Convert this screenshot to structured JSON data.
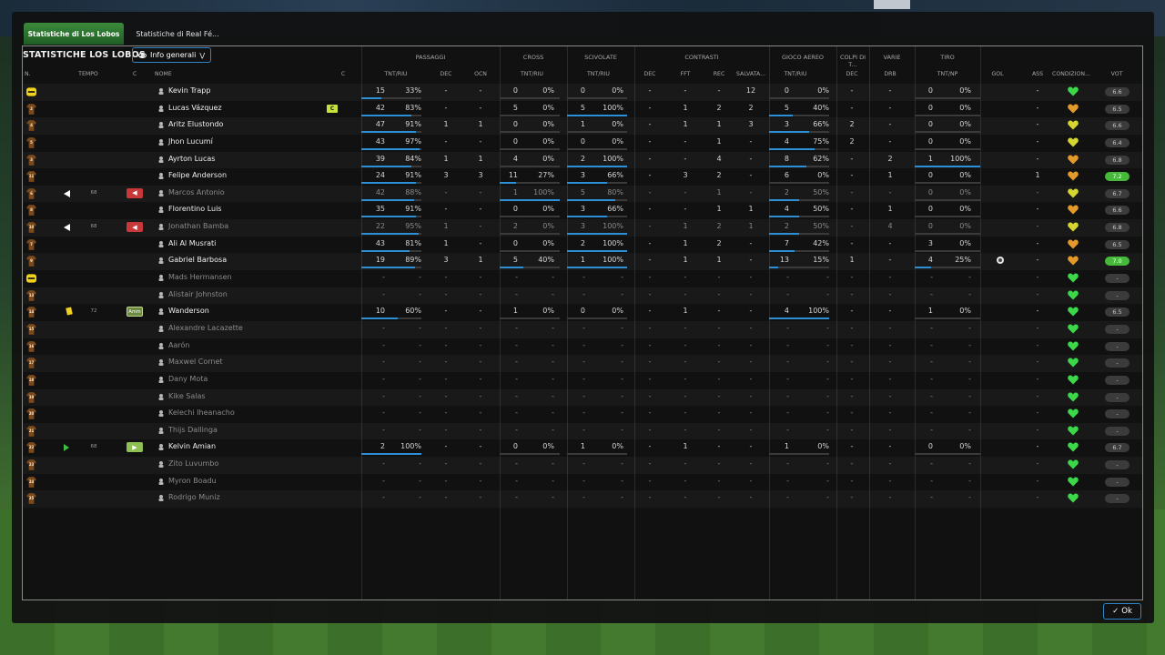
{
  "tabs": [
    {
      "label": "Statistiche di Los Lobos",
      "active": true
    },
    {
      "label": "Statistiche di Real Fé..."
    }
  ],
  "panel_title": "STATISTICHE LOS LOBOS",
  "view_selector": {
    "label": "Info generali",
    "icon": "eye-icon"
  },
  "group_headers": [
    "PASSAGGI",
    "CROSS",
    "SCIVOLATE",
    "CONTRASTI",
    "GIOCO AEREO",
    "COLPI DI T...",
    "VARIE",
    "TIRO"
  ],
  "column_headers": [
    "N.",
    "TEMPO",
    "C",
    "NOME",
    "C",
    "TNT/RIU",
    "DEC",
    "OCN",
    "TNT/RIU",
    "TNT/RIU",
    "DEC",
    "FFT",
    "REC",
    "SALVATA...",
    "TNT/RIU",
    "DEC",
    "DRB",
    "TNT/NP",
    "GOL",
    "ASS",
    "CONDIZION...",
    "VOT"
  ],
  "ok_label": "Ok",
  "accent_color": "#2f85c7",
  "players": [
    {
      "num": "1",
      "gk": true,
      "name": "Kevin Trapp",
      "pass_t": "15",
      "pass_p": "33%",
      "pass_pct": 33,
      "dec": "-",
      "ocn": "-",
      "cr_t": "0",
      "cr_p": "0%",
      "cr_pct": 0,
      "sc_t": "0",
      "sc_p": "0%",
      "sc_pct": 0,
      "con_dec": "-",
      "fft": "-",
      "rec": "-",
      "salv": "12",
      "air_t": "0",
      "air_p": "0%",
      "air_pct": 0,
      "colpi": "-",
      "drb": "-",
      "tiro_t": "0",
      "tiro_p": "0%",
      "tiro_pct": 0,
      "gol": "",
      "ass": "-",
      "cond": "green",
      "vote": "6.6",
      "dim": false
    },
    {
      "num": "2",
      "name": "Lucas Vázquez",
      "captain": "C",
      "pass_t": "42",
      "pass_p": "83%",
      "pass_pct": 83,
      "dec": "-",
      "ocn": "-",
      "cr_t": "5",
      "cr_p": "0%",
      "cr_pct": 0,
      "sc_t": "5",
      "sc_p": "100%",
      "sc_pct": 100,
      "con_dec": "-",
      "fft": "1",
      "rec": "2",
      "salv": "2",
      "air_t": "5",
      "air_p": "40%",
      "air_pct": 40,
      "colpi": "-",
      "drb": "-",
      "tiro_t": "0",
      "tiro_p": "0%",
      "tiro_pct": 0,
      "gol": "",
      "ass": "-",
      "cond": "orange",
      "vote": "6.5",
      "dim": false
    },
    {
      "num": "4",
      "name": "Aritz Elustondo",
      "pass_t": "47",
      "pass_p": "91%",
      "pass_pct": 91,
      "dec": "1",
      "ocn": "1",
      "cr_t": "0",
      "cr_p": "0%",
      "cr_pct": 0,
      "sc_t": "1",
      "sc_p": "0%",
      "sc_pct": 0,
      "con_dec": "-",
      "fft": "1",
      "rec": "1",
      "salv": "3",
      "air_t": "3",
      "air_p": "66%",
      "air_pct": 66,
      "colpi": "2",
      "drb": "-",
      "tiro_t": "0",
      "tiro_p": "0%",
      "tiro_pct": 0,
      "gol": "",
      "ass": "-",
      "cond": "yellow",
      "vote": "6.6",
      "dim": false
    },
    {
      "num": "5",
      "name": "Jhon Lucumí",
      "pass_t": "43",
      "pass_p": "97%",
      "pass_pct": 97,
      "dec": "-",
      "ocn": "-",
      "cr_t": "0",
      "cr_p": "0%",
      "cr_pct": 0,
      "sc_t": "0",
      "sc_p": "0%",
      "sc_pct": 0,
      "con_dec": "-",
      "fft": "-",
      "rec": "1",
      "salv": "-",
      "air_t": "4",
      "air_p": "75%",
      "air_pct": 75,
      "colpi": "2",
      "drb": "-",
      "tiro_t": "0",
      "tiro_p": "0%",
      "tiro_pct": 0,
      "gol": "",
      "ass": "-",
      "cond": "yellow",
      "vote": "6.4",
      "dim": false
    },
    {
      "num": "3",
      "name": "Ayrton Lucas",
      "pass_t": "39",
      "pass_p": "84%",
      "pass_pct": 84,
      "dec": "1",
      "ocn": "1",
      "cr_t": "4",
      "cr_p": "0%",
      "cr_pct": 0,
      "sc_t": "2",
      "sc_p": "100%",
      "sc_pct": 100,
      "con_dec": "-",
      "fft": "-",
      "rec": "4",
      "salv": "-",
      "air_t": "8",
      "air_p": "62%",
      "air_pct": 62,
      "colpi": "-",
      "drb": "2",
      "tiro_t": "1",
      "tiro_p": "100%",
      "tiro_pct": 100,
      "gol": "",
      "ass": "-",
      "cond": "orange",
      "vote": "6.8",
      "dim": false
    },
    {
      "num": "11",
      "name": "Felipe Anderson",
      "pass_t": "24",
      "pass_p": "91%",
      "pass_pct": 91,
      "dec": "3",
      "ocn": "3",
      "cr_t": "11",
      "cr_p": "27%",
      "cr_pct": 27,
      "sc_t": "3",
      "sc_p": "66%",
      "sc_pct": 66,
      "con_dec": "-",
      "fft": "3",
      "rec": "2",
      "salv": "-",
      "air_t": "6",
      "air_p": "0%",
      "air_pct": 0,
      "colpi": "-",
      "drb": "1",
      "tiro_t": "0",
      "tiro_p": "0%",
      "tiro_pct": 0,
      "gol": "",
      "ass": "1",
      "cond": "orange",
      "vote": "7.2",
      "vote_hi": true,
      "dim": false
    },
    {
      "num": "6",
      "sub_out": true,
      "minute": "68",
      "name": "Marcos Antonio",
      "pass_t": "42",
      "pass_p": "88%",
      "pass_pct": 88,
      "dec": "-",
      "ocn": "-",
      "cr_t": "1",
      "cr_p": "100%",
      "cr_pct": 100,
      "sc_t": "5",
      "sc_p": "80%",
      "sc_pct": 80,
      "con_dec": "-",
      "fft": "-",
      "rec": "1",
      "salv": "-",
      "air_t": "2",
      "air_p": "50%",
      "air_pct": 50,
      "colpi": "-",
      "drb": "-",
      "tiro_t": "0",
      "tiro_p": "0%",
      "tiro_pct": 0,
      "gol": "",
      "ass": "-",
      "cond": "yellow",
      "vote": "6.7",
      "dim": true
    },
    {
      "num": "8",
      "name": "Florentino Luis",
      "pass_t": "35",
      "pass_p": "91%",
      "pass_pct": 91,
      "dec": "-",
      "ocn": "-",
      "cr_t": "0",
      "cr_p": "0%",
      "cr_pct": 0,
      "sc_t": "3",
      "sc_p": "66%",
      "sc_pct": 66,
      "con_dec": "-",
      "fft": "-",
      "rec": "1",
      "salv": "1",
      "air_t": "4",
      "air_p": "50%",
      "air_pct": 50,
      "colpi": "-",
      "drb": "1",
      "tiro_t": "0",
      "tiro_p": "0%",
      "tiro_pct": 0,
      "gol": "",
      "ass": "-",
      "cond": "orange",
      "vote": "6.6",
      "dim": false
    },
    {
      "num": "10",
      "sub_out": true,
      "minute": "68",
      "name": "Jonathan Bamba",
      "pass_t": "22",
      "pass_p": "95%",
      "pass_pct": 95,
      "dec": "1",
      "ocn": "-",
      "cr_t": "2",
      "cr_p": "0%",
      "cr_pct": 0,
      "sc_t": "3",
      "sc_p": "100%",
      "sc_pct": 100,
      "con_dec": "-",
      "fft": "1",
      "rec": "2",
      "salv": "1",
      "air_t": "2",
      "air_p": "50%",
      "air_pct": 50,
      "colpi": "-",
      "drb": "4",
      "tiro_t": "0",
      "tiro_p": "0%",
      "tiro_pct": 0,
      "gol": "",
      "ass": "-",
      "cond": "yellow",
      "vote": "6.8",
      "dim": true
    },
    {
      "num": "7",
      "name": "Ali Al Musrati",
      "pass_t": "43",
      "pass_p": "81%",
      "pass_pct": 81,
      "dec": "1",
      "ocn": "-",
      "cr_t": "0",
      "cr_p": "0%",
      "cr_pct": 0,
      "sc_t": "2",
      "sc_p": "100%",
      "sc_pct": 100,
      "con_dec": "-",
      "fft": "1",
      "rec": "2",
      "salv": "-",
      "air_t": "7",
      "air_p": "42%",
      "air_pct": 42,
      "colpi": "-",
      "drb": "-",
      "tiro_t": "3",
      "tiro_p": "0%",
      "tiro_pct": 0,
      "gol": "",
      "ass": "-",
      "cond": "orange",
      "vote": "6.5",
      "dim": false
    },
    {
      "num": "9",
      "name": "Gabriel Barbosa",
      "pass_t": "19",
      "pass_p": "89%",
      "pass_pct": 89,
      "dec": "3",
      "ocn": "1",
      "cr_t": "5",
      "cr_p": "40%",
      "cr_pct": 40,
      "sc_t": "1",
      "sc_p": "100%",
      "sc_pct": 100,
      "con_dec": "-",
      "fft": "1",
      "rec": "1",
      "salv": "-",
      "air_t": "13",
      "air_p": "15%",
      "air_pct": 15,
      "colpi": "1",
      "drb": "-",
      "tiro_t": "4",
      "tiro_p": "25%",
      "tiro_pct": 25,
      "gol": "ball",
      "ass": "-",
      "cond": "orange",
      "vote": "7.0",
      "vote_hi": true,
      "dim": false
    },
    {
      "num": "12",
      "gk": true,
      "name": "Mads Hermansen",
      "pass_t": "-",
      "pass_p": "-",
      "dec": "-",
      "ocn": "-",
      "cr_t": "-",
      "cr_p": "-",
      "sc_t": "-",
      "sc_p": "-",
      "con_dec": "-",
      "fft": "-",
      "rec": "-",
      "salv": "-",
      "air_t": "-",
      "air_p": "-",
      "colpi": "-",
      "drb": "-",
      "tiro_t": "-",
      "tiro_p": "-",
      "gol": "",
      "ass": "-",
      "cond": "green",
      "vote": "-",
      "dim": true
    },
    {
      "num": "13",
      "name": "Alistair Johnston",
      "pass_t": "-",
      "pass_p": "-",
      "dec": "-",
      "ocn": "-",
      "cr_t": "-",
      "cr_p": "-",
      "sc_t": "-",
      "sc_p": "-",
      "con_dec": "-",
      "fft": "-",
      "rec": "-",
      "salv": "-",
      "air_t": "-",
      "air_p": "-",
      "colpi": "-",
      "drb": "-",
      "tiro_t": "-",
      "tiro_p": "-",
      "gol": "",
      "ass": "-",
      "cond": "green",
      "vote": "-",
      "dim": true
    },
    {
      "num": "14",
      "yellow": true,
      "minute": "72",
      "sub_tag": "Amm",
      "name": "Wanderson",
      "pass_t": "10",
      "pass_p": "60%",
      "pass_pct": 60,
      "dec": "-",
      "ocn": "-",
      "cr_t": "1",
      "cr_p": "0%",
      "cr_pct": 0,
      "sc_t": "0",
      "sc_p": "0%",
      "sc_pct": 0,
      "con_dec": "-",
      "fft": "1",
      "rec": "-",
      "salv": "-",
      "air_t": "4",
      "air_p": "100%",
      "air_pct": 100,
      "colpi": "-",
      "drb": "-",
      "tiro_t": "1",
      "tiro_p": "0%",
      "tiro_pct": 0,
      "gol": "",
      "ass": "-",
      "cond": "green",
      "vote": "6.5",
      "dim": false
    },
    {
      "num": "15",
      "name": "Alexandre Lacazette",
      "pass_t": "-",
      "pass_p": "-",
      "dec": "-",
      "ocn": "-",
      "cr_t": "-",
      "cr_p": "-",
      "sc_t": "-",
      "sc_p": "-",
      "con_dec": "-",
      "fft": "-",
      "rec": "-",
      "salv": "-",
      "air_t": "-",
      "air_p": "-",
      "colpi": "-",
      "drb": "-",
      "tiro_t": "-",
      "tiro_p": "-",
      "gol": "",
      "ass": "-",
      "cond": "green",
      "vote": "-",
      "dim": true
    },
    {
      "num": "16",
      "name": "Aarón",
      "pass_t": "-",
      "pass_p": "-",
      "dec": "-",
      "ocn": "-",
      "cr_t": "-",
      "cr_p": "-",
      "sc_t": "-",
      "sc_p": "-",
      "con_dec": "-",
      "fft": "-",
      "rec": "-",
      "salv": "-",
      "air_t": "-",
      "air_p": "-",
      "colpi": "-",
      "drb": "-",
      "tiro_t": "-",
      "tiro_p": "-",
      "gol": "",
      "ass": "-",
      "cond": "green",
      "vote": "-",
      "dim": true
    },
    {
      "num": "17",
      "name": "Maxwel Cornet",
      "pass_t": "-",
      "pass_p": "-",
      "dec": "-",
      "ocn": "-",
      "cr_t": "-",
      "cr_p": "-",
      "sc_t": "-",
      "sc_p": "-",
      "con_dec": "-",
      "fft": "-",
      "rec": "-",
      "salv": "-",
      "air_t": "-",
      "air_p": "-",
      "colpi": "-",
      "drb": "-",
      "tiro_t": "-",
      "tiro_p": "-",
      "gol": "",
      "ass": "-",
      "cond": "green",
      "vote": "-",
      "dim": true
    },
    {
      "num": "18",
      "name": "Dany Mota",
      "pass_t": "-",
      "pass_p": "-",
      "dec": "-",
      "ocn": "-",
      "cr_t": "-",
      "cr_p": "-",
      "sc_t": "-",
      "sc_p": "-",
      "con_dec": "-",
      "fft": "-",
      "rec": "-",
      "salv": "-",
      "air_t": "-",
      "air_p": "-",
      "colpi": "-",
      "drb": "-",
      "tiro_t": "-",
      "tiro_p": "-",
      "gol": "",
      "ass": "-",
      "cond": "green",
      "vote": "-",
      "dim": true
    },
    {
      "num": "19",
      "name": "Kike Salas",
      "pass_t": "-",
      "pass_p": "-",
      "dec": "-",
      "ocn": "-",
      "cr_t": "-",
      "cr_p": "-",
      "sc_t": "-",
      "sc_p": "-",
      "con_dec": "-",
      "fft": "-",
      "rec": "-",
      "salv": "-",
      "air_t": "-",
      "air_p": "-",
      "colpi": "-",
      "drb": "-",
      "tiro_t": "-",
      "tiro_p": "-",
      "gol": "",
      "ass": "-",
      "cond": "green",
      "vote": "-",
      "dim": true
    },
    {
      "num": "20",
      "name": "Kelechi Iheanacho",
      "pass_t": "-",
      "pass_p": "-",
      "dec": "-",
      "ocn": "-",
      "cr_t": "-",
      "cr_p": "-",
      "sc_t": "-",
      "sc_p": "-",
      "con_dec": "-",
      "fft": "-",
      "rec": "-",
      "salv": "-",
      "air_t": "-",
      "air_p": "-",
      "colpi": "-",
      "drb": "-",
      "tiro_t": "-",
      "tiro_p": "-",
      "gol": "",
      "ass": "-",
      "cond": "green",
      "vote": "-",
      "dim": true
    },
    {
      "num": "21",
      "name": "Thijs Dallinga",
      "pass_t": "-",
      "pass_p": "-",
      "dec": "-",
      "ocn": "-",
      "cr_t": "-",
      "cr_p": "-",
      "sc_t": "-",
      "sc_p": "-",
      "con_dec": "-",
      "fft": "-",
      "rec": "-",
      "salv": "-",
      "air_t": "-",
      "air_p": "-",
      "colpi": "-",
      "drb": "-",
      "tiro_t": "-",
      "tiro_p": "-",
      "gol": "",
      "ass": "-",
      "cond": "green",
      "vote": "-",
      "dim": true
    },
    {
      "num": "22",
      "sub_in": true,
      "minute": "68",
      "name": "Kelvin Amian",
      "pass_t": "2",
      "pass_p": "100%",
      "pass_pct": 100,
      "dec": "-",
      "ocn": "-",
      "cr_t": "0",
      "cr_p": "0%",
      "cr_pct": 0,
      "sc_t": "1",
      "sc_p": "0%",
      "sc_pct": 0,
      "con_dec": "-",
      "fft": "1",
      "rec": "-",
      "salv": "-",
      "air_t": "1",
      "air_p": "0%",
      "air_pct": 0,
      "colpi": "-",
      "drb": "-",
      "tiro_t": "0",
      "tiro_p": "0%",
      "tiro_pct": 0,
      "gol": "",
      "ass": "-",
      "cond": "green",
      "vote": "6.7",
      "dim": false
    },
    {
      "num": "23",
      "name": "Zito Luvumbo",
      "pass_t": "-",
      "pass_p": "-",
      "dec": "-",
      "ocn": "-",
      "cr_t": "-",
      "cr_p": "-",
      "sc_t": "-",
      "sc_p": "-",
      "con_dec": "-",
      "fft": "-",
      "rec": "-",
      "salv": "-",
      "air_t": "-",
      "air_p": "-",
      "colpi": "-",
      "drb": "-",
      "tiro_t": "-",
      "tiro_p": "-",
      "gol": "",
      "ass": "-",
      "cond": "green",
      "vote": "-",
      "dim": true
    },
    {
      "num": "24",
      "name": "Myron Boadu",
      "pass_t": "-",
      "pass_p": "-",
      "dec": "-",
      "ocn": "-",
      "cr_t": "-",
      "cr_p": "-",
      "sc_t": "-",
      "sc_p": "-",
      "con_dec": "-",
      "fft": "-",
      "rec": "-",
      "salv": "-",
      "air_t": "-",
      "air_p": "-",
      "colpi": "-",
      "drb": "-",
      "tiro_t": "-",
      "tiro_p": "-",
      "gol": "",
      "ass": "-",
      "cond": "green",
      "vote": "-",
      "dim": true
    },
    {
      "num": "25",
      "name": "Rodrigo Muniz",
      "pass_t": "-",
      "pass_p": "-",
      "dec": "-",
      "ocn": "-",
      "cr_t": "-",
      "cr_p": "-",
      "sc_t": "-",
      "sc_p": "-",
      "con_dec": "-",
      "fft": "-",
      "rec": "-",
      "salv": "-",
      "air_t": "-",
      "air_p": "-",
      "colpi": "-",
      "drb": "-",
      "tiro_t": "-",
      "tiro_p": "-",
      "gol": "",
      "ass": "-",
      "cond": "green",
      "vote": "-",
      "dim": true
    }
  ],
  "colors": {
    "green": "#3bd94a",
    "yellow": "#d6d630",
    "orange": "#e39a2a",
    "bar": "#2d8fd6"
  }
}
